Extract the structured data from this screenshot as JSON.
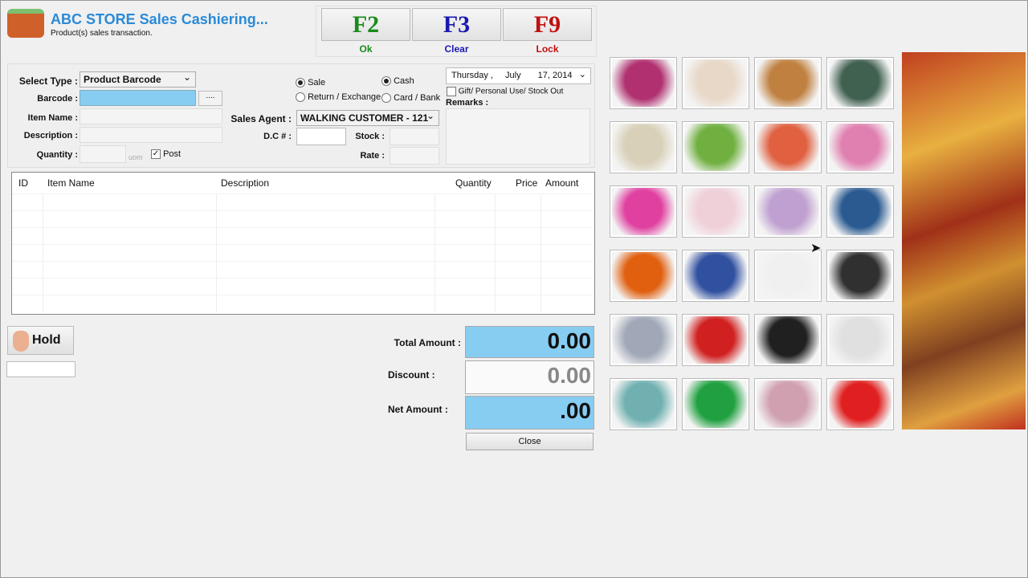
{
  "header": {
    "title": "ABC STORE Sales Cashiering...",
    "subtitle": "Product(s) sales transaction."
  },
  "fkeys": [
    {
      "key": "F2",
      "caption": "Ok",
      "color": "#1a8a1a"
    },
    {
      "key": "F3",
      "caption": "Clear",
      "color": "#1a1ab0"
    },
    {
      "key": "F9",
      "caption": "Lock",
      "color": "#c01010"
    }
  ],
  "form": {
    "select_type_label": "Select Type :",
    "select_type_value": "Product Barcode",
    "barcode_label": "Barcode :",
    "browse_label": "....",
    "item_name_label": "Item Name :",
    "description_label": "Description :",
    "quantity_label": "Quantity :",
    "uom": "uom",
    "post_label": "Post",
    "sale_label": "Sale",
    "return_label": "Return / Exchange",
    "cash_label": "Cash",
    "card_label": "Card / Bank",
    "sales_agent_label": "Sales Agent :",
    "sales_agent_value": "WALKING CUSTOMER - 121",
    "dc_label": "D.C # :",
    "stock_label": "Stock :",
    "rate_label": "Rate :",
    "date_day": "Thursday ,",
    "date_month": "July",
    "date_rest": "17, 2014",
    "gift_label": "Gift/ Personal Use/ Stock Out",
    "remarks_label": "Remarks :"
  },
  "table": {
    "columns": [
      "ID",
      "Item Name",
      "Description",
      "Quantity",
      "Price",
      "Amount"
    ]
  },
  "hold_label": "Hold",
  "totals": {
    "total_label": "Total Amount :",
    "total_value": "0.00",
    "discount_label": "Discount :",
    "discount_value": "0.00",
    "net_label": "Net Amount :",
    "net_value": ".00",
    "close_label": "Close"
  },
  "products": [
    {
      "icon": "dress-icon",
      "color": "#b03070"
    },
    {
      "icon": "kurti-icon",
      "color": "#e8d8c8"
    },
    {
      "icon": "suit-icon",
      "color": "#c08040"
    },
    {
      "icon": "saree-icon",
      "color": "#406050"
    },
    {
      "icon": "handbag-icon",
      "color": "#d8d0b8"
    },
    {
      "icon": "toy-box-icon",
      "color": "#70b040"
    },
    {
      "icon": "kids-shirts-icon",
      "color": "#e06040"
    },
    {
      "icon": "baby-dress-icon",
      "color": "#e080b0"
    },
    {
      "icon": "perfume-icon",
      "color": "#e040a0"
    },
    {
      "icon": "cream-icon",
      "color": "#f0d0d8"
    },
    {
      "icon": "bracelets-icon",
      "color": "#c0a0d0"
    },
    {
      "icon": "necklace-icon",
      "color": "#2a5a90"
    },
    {
      "icon": "plug-icon",
      "color": "#e06010"
    },
    {
      "icon": "razor-pack-icon",
      "color": "#3050a0"
    },
    {
      "icon": "scissors-icon",
      "color": "#f0f0f0"
    },
    {
      "icon": "flashlight-icon",
      "color": "#303030"
    },
    {
      "icon": "cutlery-stand-icon",
      "color": "#a0a8b8"
    },
    {
      "icon": "fire-extinguisher-icon",
      "color": "#d02020"
    },
    {
      "icon": "mobile-phone-icon",
      "color": "#202020"
    },
    {
      "icon": "telephone-icon",
      "color": "#e0e0e0"
    },
    {
      "icon": "network-tester-icon",
      "color": "#70b0b0"
    },
    {
      "icon": "tape-dispenser-icon",
      "color": "#20a040"
    },
    {
      "icon": "model-icon",
      "color": "#d0a0b0"
    },
    {
      "icon": "receipt-printer-icon",
      "color": "#e02020"
    }
  ]
}
